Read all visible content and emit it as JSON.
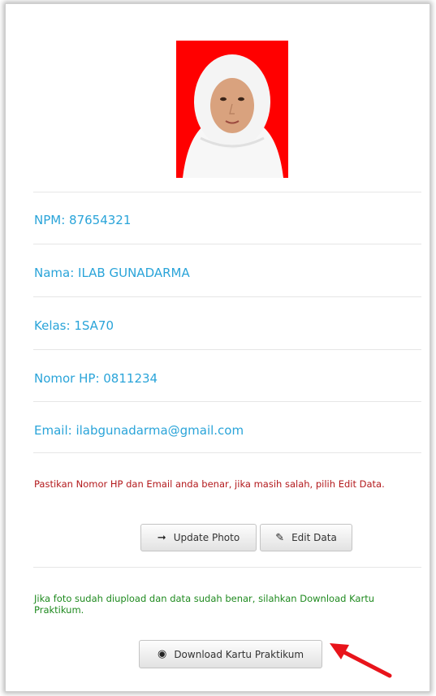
{
  "profile": {
    "npm": "NPM: 87654321",
    "nama": "Nama: ILAB GUNADARMA",
    "kelas": "Kelas: 1SA70",
    "nomor_hp": "Nomor HP: 0811234",
    "email": "Email: ilabgunadarma@gmail.com"
  },
  "warning_text": "Pastikan Nomor HP dan Email anda benar, jika masih salah, pilih Edit Data.",
  "buttons": {
    "update_photo": "Update Photo",
    "update_photo_icon": "login-icon",
    "edit_data": "Edit Data",
    "edit_data_icon": "edit-icon",
    "download": "Download Kartu Praktikum",
    "download_icon": "circle-arrow-icon"
  },
  "info_text": "Jika foto sudah diupload dan data sudah benar, silahkan Download Kartu Praktikum.",
  "colors": {
    "info_text": "#2aa4d9",
    "warning_text": "#b3191c",
    "success_text": "#1f8a1f",
    "photo_background": "#ff0000",
    "arrow": "#e8141b"
  }
}
